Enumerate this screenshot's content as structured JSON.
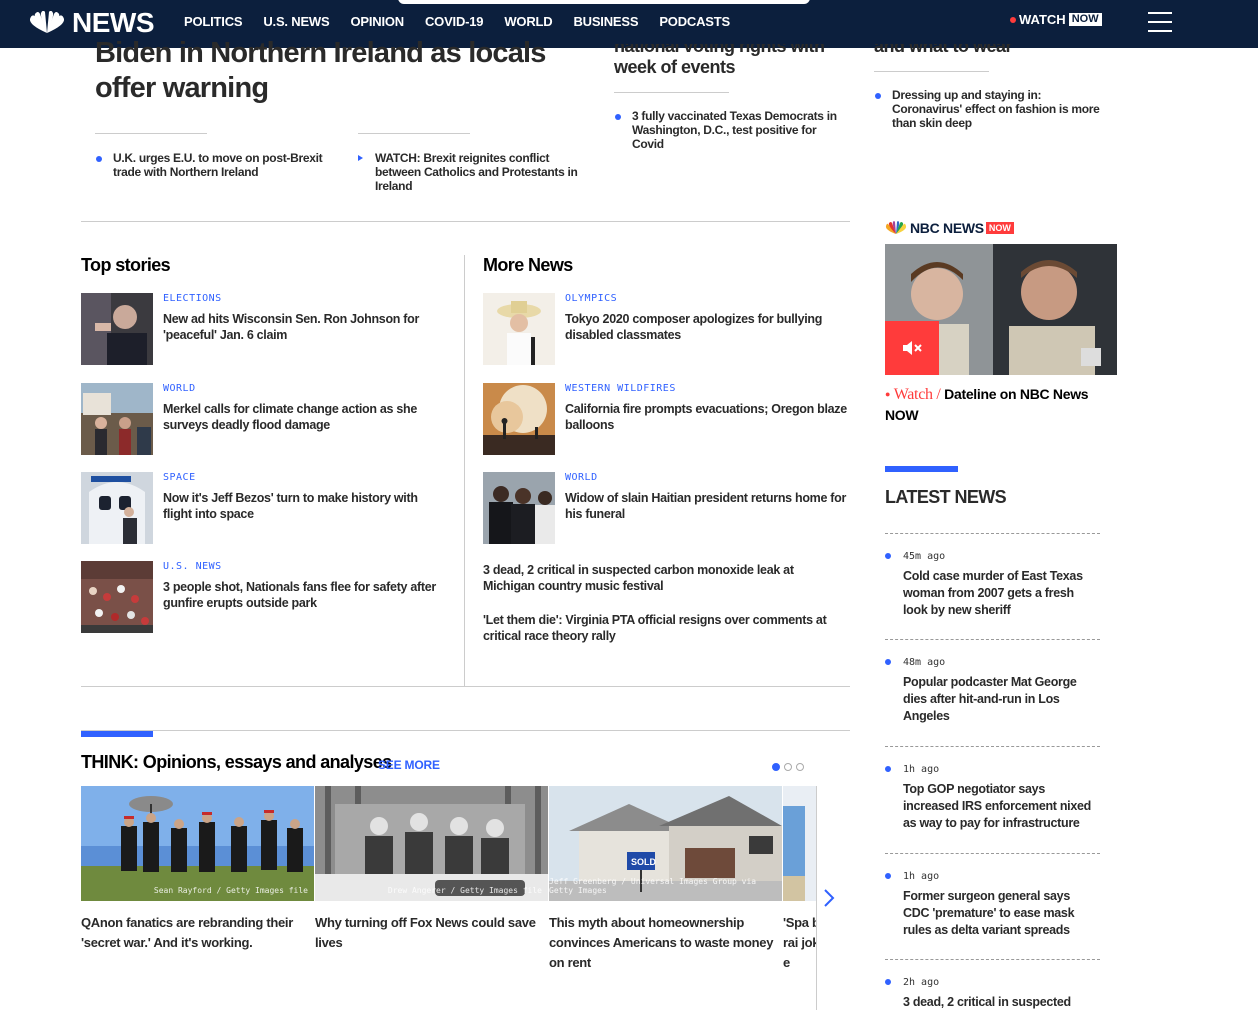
{
  "nav": {
    "brand": "NEWS",
    "links": [
      "POLITICS",
      "U.S. NEWS",
      "OPINION",
      "COVID-19",
      "WORLD",
      "BUSINESS",
      "PODCASTS"
    ],
    "watch": "WATCH",
    "now": "NOW"
  },
  "hero": {
    "title": "Biden in Northern Ireland as locals offer warning",
    "related": [
      "U.K. urges E.U. to move on post-Brexit trade with Northern Ireland",
      "WATCH: Brexit reignites conflict between Catholics and Protestants in Ireland"
    ]
  },
  "mid": {
    "title_partial": "national voting rights with week of events",
    "related": "3 fully vaccinated Texas Democrats in Washington, D.C., test positive for Covid"
  },
  "right": {
    "title_partial": "and what to wear",
    "related": "Dressing up and staying in: Coronavirus' effect on fashion is more than skin deep"
  },
  "top_stories": {
    "heading": "Top stories",
    "items": [
      {
        "eyebrow": "ELECTIONS",
        "headline": "New ad hits Wisconsin Sen. Ron Johnson for 'peaceful' Jan. 6 claim"
      },
      {
        "eyebrow": "WORLD",
        "headline": "Merkel calls for climate change action as she surveys deadly flood damage"
      },
      {
        "eyebrow": "SPACE",
        "headline": "Now it's Jeff Bezos' turn to make history with flight into space"
      },
      {
        "eyebrow": "U.S. NEWS",
        "headline": "3 people shot, Nationals fans flee for safety after gunfire erupts outside park"
      }
    ]
  },
  "more_news": {
    "heading": "More News",
    "items": [
      {
        "eyebrow": "OLYMPICS",
        "headline": "Tokyo 2020 composer apologizes for bullying disabled classmates"
      },
      {
        "eyebrow": "WESTERN WILDFIRES",
        "headline": "California fire prompts evacuations; Oregon blaze balloons"
      },
      {
        "eyebrow": "WORLD",
        "headline": "Widow of slain Haitian president returns home for his funeral"
      }
    ],
    "plain": [
      "3 dead, 2 critical in suspected carbon monoxide leak at Michigan country music festival",
      "'Let them die': Virginia PTA official resigns over comments at critical race theory rally"
    ]
  },
  "think": {
    "heading": "THINK: Opinions, essays and analyses",
    "see_more": "SEE MORE",
    "cards": [
      {
        "title": "QAnon fanatics are rebranding their 'secret war.' And it's working.",
        "credit": "Sean Rayford / Getty Images file"
      },
      {
        "title": "Why turning off Fox News could save lives",
        "credit": "Drew Angerer / Getty Images file"
      },
      {
        "title": "This myth about homeownership convinces Americans to waste money on rent",
        "credit": "Jeff Greenberg / Universal Images Group via Getty Images"
      },
      {
        "title": "'Spa brai joke",
        "credit": ""
      }
    ],
    "sold_sign": "SOLD"
  },
  "rail": {
    "brand": "NBC NEWS",
    "now": "NOW",
    "watch_word": "Watch /",
    "show": "Dateline on NBC News NOW",
    "latest_heading": "LATEST NEWS",
    "latest": [
      {
        "time": "45m ago",
        "title": "Cold case murder of East Texas woman from 2007 gets a fresh look by new sheriff"
      },
      {
        "time": "48m ago",
        "title": "Popular podcaster Mat George dies after hit-and-run in Los Angeles"
      },
      {
        "time": "1h ago",
        "title": "Top GOP negotiator says increased IRS enforcement nixed as way to pay for infrastructure"
      },
      {
        "time": "1h ago",
        "title": "Former surgeon general says CDC 'premature' to ease mask rules as delta variant spreads"
      },
      {
        "time": "2h ago",
        "title": "3 dead, 2 critical in suspected"
      }
    ]
  },
  "colors": {
    "navy": "#0c1f3d",
    "accent": "#3061ff",
    "red": "#ff3b3b"
  }
}
